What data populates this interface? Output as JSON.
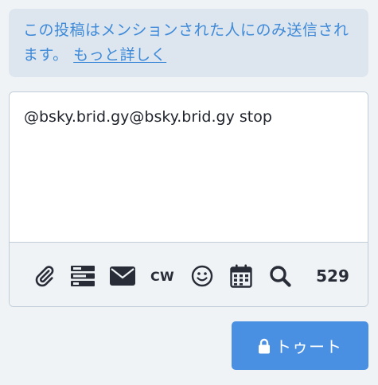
{
  "notice": {
    "text": "この投稿はメンションされた人にのみ送信されます。",
    "link_label": "もっと詳しく"
  },
  "compose": {
    "text": "@bsky.brid.gy@bsky.brid.gy stop"
  },
  "toolbar": {
    "icons": [
      "paperclip-icon",
      "poll-icon",
      "envelope-icon",
      "cw-icon",
      "emoji-icon",
      "calendar-icon",
      "search-icon"
    ],
    "cw_label": "CW",
    "char_count": "529"
  },
  "submit": {
    "label": "トゥート",
    "icon": "lock-icon"
  },
  "colors": {
    "accent": "#4a90e2",
    "notice_text": "#3f8ad8",
    "notice_bg": "#dde6ef",
    "page_bg": "#eff3f5"
  }
}
